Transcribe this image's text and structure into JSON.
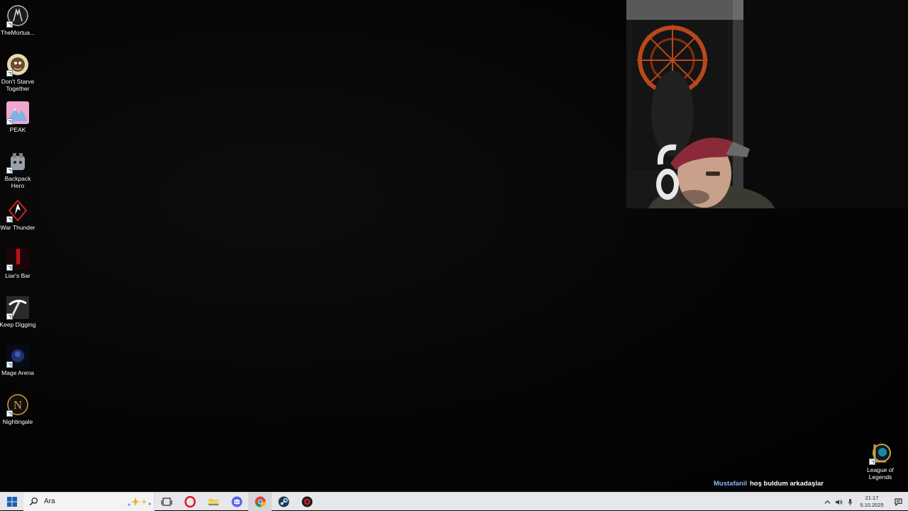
{
  "desktop_icons": [
    {
      "label": "TheMortua...",
      "icon": "mortuary-assistant-icon",
      "color": "#cfcfcf"
    },
    {
      "label": "Don't Starve Together",
      "icon": "dont-starve-together-icon",
      "color": "#e8d8b0"
    },
    {
      "label": "PEAK",
      "icon": "peak-icon",
      "color": "#f0a8d0"
    },
    {
      "label": "Backpack Hero",
      "icon": "backpack-hero-icon",
      "color": "#9aa0a8"
    },
    {
      "label": "War Thunder",
      "icon": "war-thunder-icon",
      "color": "#d02020"
    },
    {
      "label": "Liar's Bar",
      "icon": "liars-bar-icon",
      "color": "#c0101a"
    },
    {
      "label": "Keep Digging",
      "icon": "keep-digging-icon",
      "color": "#ffffff"
    },
    {
      "label": "Mage Arena",
      "icon": "mage-arena-icon",
      "color": "#20306a"
    },
    {
      "label": "Nightingale",
      "icon": "nightingale-icon",
      "color": "#d8a030"
    }
  ],
  "right_icon": {
    "label": "League of Legends",
    "icon": "league-of-legends-icon",
    "color": "#c8a040"
  },
  "overlay": {
    "user": "Mustafanil",
    "message": "hoş buldum arkadaşlar",
    "user_color": "#8fb7ff"
  },
  "taskbar": {
    "search_placeholder": "Ara",
    "apps": [
      "opera-icon",
      "file-explorer-icon",
      "discord-icon",
      "chrome-icon",
      "steam-icon",
      "app-icon"
    ],
    "clock": {
      "time": "21:17",
      "date": "5.10.2025"
    }
  }
}
